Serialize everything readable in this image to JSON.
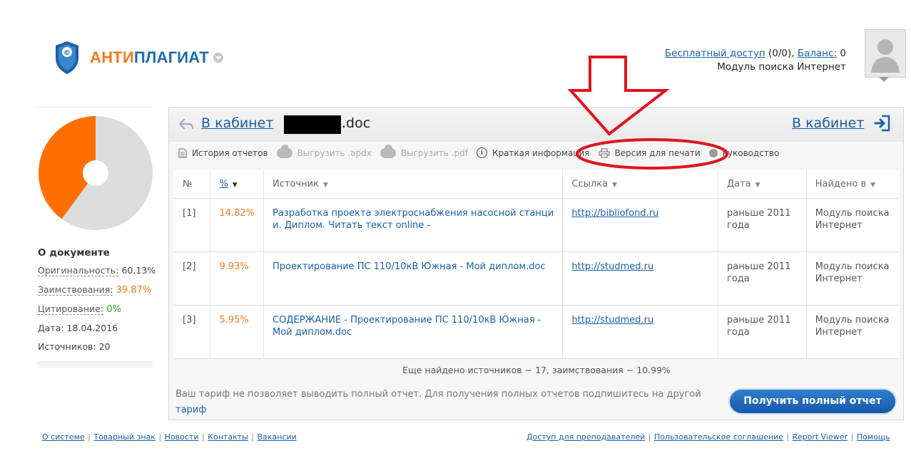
{
  "header": {
    "brand_part1": "АНТИ",
    "brand_part2": "ПЛАГИАТ",
    "free_access_link": "Бесплатный доступ",
    "free_access_count": " (0/0), ",
    "balance_link": "Баланс:",
    "balance_value": " 0",
    "search_module": "Модуль поиска Интернет"
  },
  "sidebar": {
    "chart_data": {
      "type": "pie",
      "values": [
        60.13,
        39.87
      ],
      "colors": [
        "#dcdcdc",
        "#ff6f00"
      ]
    },
    "about_title": "О документе",
    "originality_label": "Оригинальность:",
    "originality_value": "60.13%",
    "borrowing_label": "Заимствования:",
    "borrowing_value": "39.87%",
    "citation_label": "Цитирование:",
    "citation_value": "0%",
    "date_text": "Дата: 18.04.2016",
    "sources_text": "Источников: 20"
  },
  "panel": {
    "back_link": "В кабинет",
    "doc_ext": ".doc",
    "cabinet_link": "В кабинет"
  },
  "toolbar": {
    "history": "История отчетов",
    "export_apdx": "Выгрузить .apdx",
    "export_pdf": "Выгрузить .pdf",
    "brief": "Краткая информация",
    "print_version": "Версия для печати",
    "guide": "Руководство"
  },
  "table": {
    "headers": {
      "num": "№",
      "pct": "%",
      "source": "Источник",
      "link": "Ссылка",
      "date": "Дата",
      "found": "Найдено в"
    },
    "rows": [
      {
        "num": "[1]",
        "pct": "14.82%",
        "source": "Разработка проекта электроснабжения насосной станци и. Диплом. Читать текст online -",
        "link": "http://bibliofond.ru",
        "date": "раньше 2011 года",
        "found": "Модуль поиска Интернет"
      },
      {
        "num": "[2]",
        "pct": "9.93%",
        "source": "Проектирование ПС 110/10кВ Южная - Мой диплом.doc",
        "link": "http://studmed.ru",
        "date": "раньше 2011 года",
        "found": "Модуль поиска Интернет"
      },
      {
        "num": "[3]",
        "pct": "5.95%",
        "source": "СОДЕРЖАНИЕ - Проектирование ПС 110/10кВ Южная - Мой диплом.doc",
        "link": "http://studmed.ru",
        "date": "раньше 2011 года",
        "found": "Модуль поиска Интернет"
      }
    ]
  },
  "more_found": "Еще найдено источников − 17, заимствования − 10.99%",
  "tariff_text": "Ваш тариф не позволяет выводить полный отчет. Для получения полных отчетов подпишитесь на другой",
  "tariff_link": "тариф",
  "full_report_button": "Получить полный отчет",
  "footer_left": [
    "О системе",
    "Товарный знак",
    "Новости",
    "Контакты",
    "Вакансии"
  ],
  "footer_right": [
    "Доступ для преподавателей",
    "Пользовательское соглашение",
    "Report Viewer",
    "Помощь"
  ],
  "colors": {
    "accent_orange": "#f07a1a",
    "link_blue": "#1a5fa8",
    "annotation_red": "#e0141e"
  },
  "icons": [
    "shield-logo-icon",
    "back-arrow-icon",
    "door-exit-icon",
    "document-icon",
    "cloud-download-icon",
    "info-icon",
    "printer-icon",
    "help-icon"
  ]
}
